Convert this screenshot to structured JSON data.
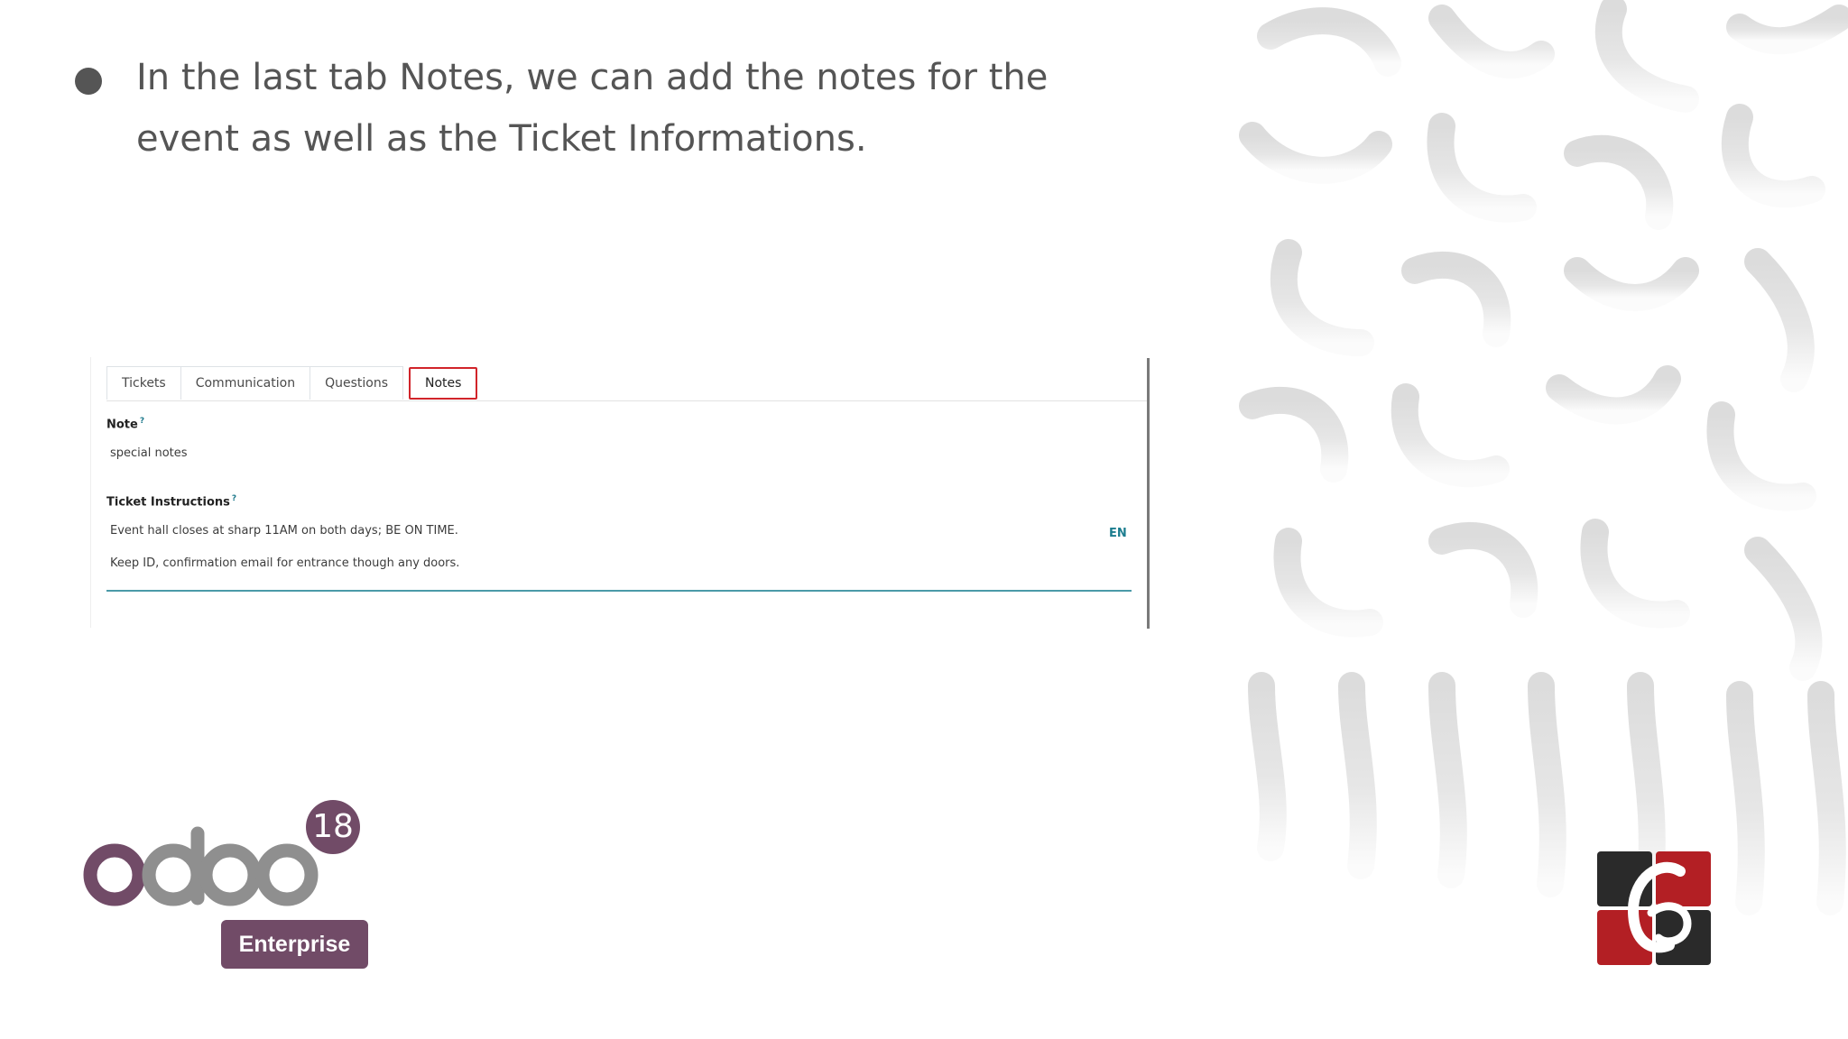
{
  "slide": {
    "bullet_text": "In the last tab Notes,  we can add the notes for the event as well as the Ticket Informations."
  },
  "form": {
    "tabs": [
      {
        "label": "Tickets"
      },
      {
        "label": "Communication"
      },
      {
        "label": "Questions"
      },
      {
        "label": "Notes",
        "active": true
      }
    ],
    "note_label": "Note",
    "note_help": "?",
    "note_value": "special notes",
    "ticket_label": "Ticket Instructions",
    "ticket_help": "?",
    "ticket_line1": "Event hall closes at sharp 11AM on both days; BE ON TIME.",
    "ticket_line2": "Keep ID, confirmation email for entrance though any doors.",
    "lang": "EN"
  },
  "logo": {
    "wordmark": "odoo",
    "version": "18",
    "edition": "Enterprise"
  },
  "colors": {
    "odoo_purple": "#714b67",
    "odoo_gray": "#8f8f8f",
    "active_tab_border": "#d1242a",
    "accent_teal": "#1c7d8f"
  }
}
